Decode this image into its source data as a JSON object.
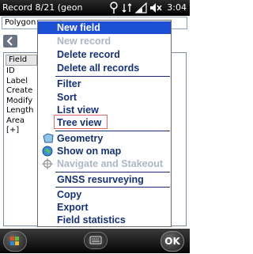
{
  "titlebar": {
    "title": "Record 8/21 (geon",
    "time": "3:04"
  },
  "form": {
    "layer_select": "Polygon",
    "column_header": "Field",
    "fields": [
      "ID",
      "Label",
      "Create",
      "Modify",
      "Length",
      "Area",
      "[+]"
    ]
  },
  "menu": {
    "items": [
      {
        "label": "New field",
        "state": "selected"
      },
      {
        "label": "New record",
        "state": "disabled"
      },
      {
        "label": "Delete record",
        "state": "enabled"
      },
      {
        "label": "Delete all records",
        "state": "enabled"
      },
      {
        "label": "Filter",
        "state": "enabled"
      },
      {
        "label": "Sort",
        "state": "enabled"
      },
      {
        "label": "List view",
        "state": "enabled"
      },
      {
        "label": "Tree view",
        "state": "highlighted"
      },
      {
        "label": "Geometry",
        "state": "enabled",
        "icon": "polygon-icon"
      },
      {
        "label": "Show on map",
        "state": "enabled",
        "icon": "globe-icon"
      },
      {
        "label": "Navigate and Stakeout",
        "state": "disabled",
        "icon": "crosshair-icon"
      },
      {
        "label": "GNSS resurveying",
        "state": "enabled"
      },
      {
        "label": "Copy",
        "state": "enabled"
      },
      {
        "label": "Export",
        "state": "enabled"
      },
      {
        "label": "Field statistics",
        "state": "enabled"
      }
    ]
  },
  "bottombar": {
    "ok_label": "OK"
  },
  "colors": {
    "menu_text": "#14317a",
    "menu_selected_bg": "#1c4fd6",
    "menu_disabled": "#aeb6c6",
    "highlight_box": "#e06b6b"
  }
}
